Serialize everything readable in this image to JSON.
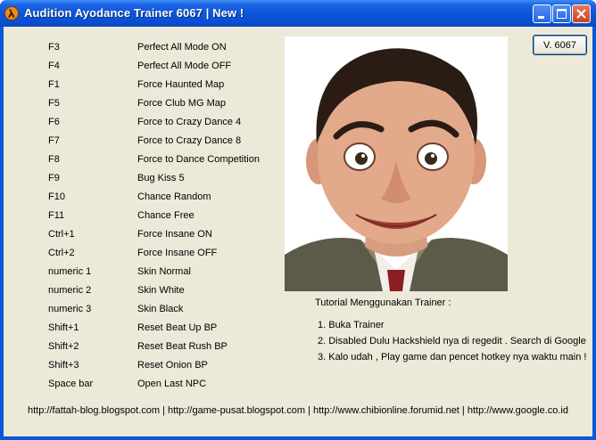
{
  "window": {
    "title": "Audition Ayodance Trainer 6067 | New !"
  },
  "hotkeys": [
    {
      "key": "F3",
      "action": "Perfect All Mode ON"
    },
    {
      "key": "F4",
      "action": "Perfect All Mode OFF"
    },
    {
      "key": "F1",
      "action": "Force Haunted Map"
    },
    {
      "key": "F5",
      "action": "Force Club MG Map"
    },
    {
      "key": "F6",
      "action": "Force to Crazy Dance 4"
    },
    {
      "key": "F7",
      "action": "Force to Crazy Dance 8"
    },
    {
      "key": "F8",
      "action": "Force to Dance Competition"
    },
    {
      "key": "F9",
      "action": "Bug Kiss 5"
    },
    {
      "key": "F10",
      "action": "Chance Random"
    },
    {
      "key": "F11",
      "action": "Chance Free"
    },
    {
      "key": "Ctrl+1",
      "action": "Force Insane ON"
    },
    {
      "key": "Ctrl+2",
      "action": "Force Insane OFF"
    },
    {
      "key": "numeric 1",
      "action": "Skin Normal"
    },
    {
      "key": "numeric 2",
      "action": "Skin White"
    },
    {
      "key": "numeric 3",
      "action": "Skin Black"
    },
    {
      "key": "Shift+1",
      "action": "Reset Beat Up BP"
    },
    {
      "key": "Shift+2",
      "action": "Reset Beat Rush BP"
    },
    {
      "key": "Shift+3",
      "action": "Reset Onion BP"
    },
    {
      "key": "Space bar",
      "action": "Open Last NPC"
    }
  ],
  "version_button": "V. 6067",
  "tutorial": {
    "title": "Tutorial Menggunakan Trainer :",
    "steps": [
      "1. Buka Trainer",
      "2. Disabled Dulu Hackshield nya di regedit . Search di Google",
      "3. Kalo udah , Play game dan pencet hotkey nya waktu main !"
    ]
  },
  "footer_links": "http://fattah-blog.blogspot.com | http://game-pusat.blogspot.com | http://www.chibionline.forumid.net | http://www.google.co.id",
  "icons": {
    "app": "half-life-lambda-icon",
    "minimize": "minimize-icon",
    "maximize": "maximize-icon",
    "close": "close-icon"
  },
  "colors": {
    "titlebar": "#0a54d8",
    "client_bg": "#ece9d8",
    "close_button": "#d4512b"
  }
}
